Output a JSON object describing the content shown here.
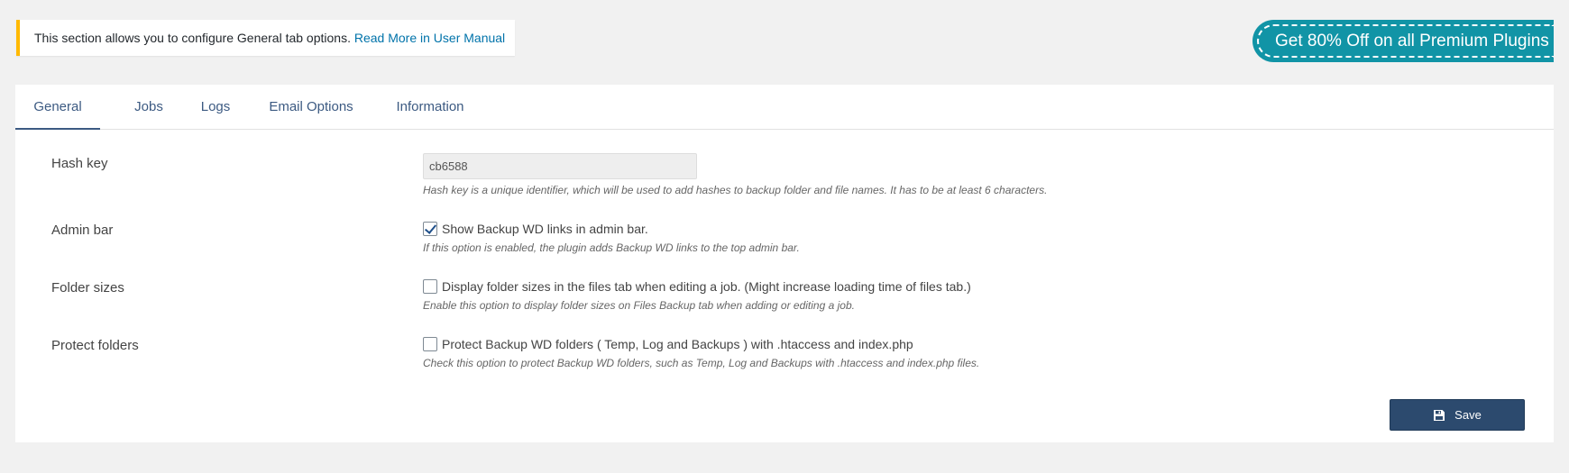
{
  "notice": {
    "text": "This section allows you to configure General tab options. ",
    "link": "Read More in User Manual"
  },
  "promo": {
    "text": "Get 80% Off  on all Premium Plugins"
  },
  "tabs": [
    {
      "label": "General",
      "active": true
    },
    {
      "label": "Jobs"
    },
    {
      "label": "Logs"
    },
    {
      "label": "Email Options"
    },
    {
      "label": "Information"
    }
  ],
  "fields": {
    "hash_key": {
      "label": "Hash key",
      "value": "cb6588",
      "description": "Hash key is a unique identifier, which will be used to add hashes to backup folder and file names. It has to be at least 6 characters."
    },
    "admin_bar": {
      "label": "Admin bar",
      "checked": true,
      "option": "Show Backup WD links in admin bar.",
      "description": "If this option is enabled, the plugin adds Backup WD links to the top admin bar."
    },
    "folder_sizes": {
      "label": "Folder sizes",
      "checked": false,
      "option": "Display folder sizes in the files tab when editing a job. (Might increase loading time of files tab.)",
      "description": "Enable this option to display folder sizes on Files Backup tab when adding or editing a job."
    },
    "protect_folders": {
      "label": "Protect folders",
      "checked": false,
      "option": "Protect Backup WD folders ( Temp, Log and Backups ) with .htaccess and index.php",
      "description": "Check this option to protect Backup WD folders, such as Temp, Log and Backups with .htaccess and index.php files."
    }
  },
  "save_button": {
    "label": "Save",
    "icon": "save-icon"
  },
  "colors": {
    "accent": "#3c5a82",
    "promo": "#1194a6",
    "notice_border": "#ffb900",
    "button": "#2c4a6e"
  }
}
